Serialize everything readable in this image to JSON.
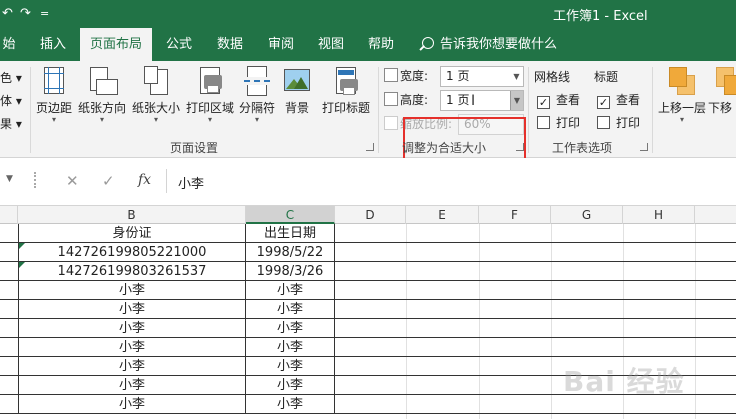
{
  "window": {
    "title": "工作簿1 - Excel",
    "undo_glyph": "↶",
    "redo_glyph": "↷",
    "qat_more": "="
  },
  "tabs": [
    {
      "label": "始",
      "active": false
    },
    {
      "label": "插入",
      "active": false
    },
    {
      "label": "页面布局",
      "active": true
    },
    {
      "label": "公式",
      "active": false
    },
    {
      "label": "数据",
      "active": false
    },
    {
      "label": "审阅",
      "active": false
    },
    {
      "label": "视图",
      "active": false
    },
    {
      "label": "帮助",
      "active": false
    }
  ],
  "tell_me": "告诉我你想要做什么",
  "ribbon": {
    "left_edge": [
      "色 ▾",
      "体 ▾",
      "果 ▾"
    ],
    "page_setup": {
      "buttons": [
        {
          "label": "页边距",
          "icon": "margins-icon"
        },
        {
          "label": "纸张方向",
          "icon": "orientation-icon"
        },
        {
          "label": "纸张大小",
          "icon": "size-icon"
        },
        {
          "label": "打印区域",
          "icon": "print-area-icon"
        },
        {
          "label": "分隔符",
          "icon": "breaks-icon"
        },
        {
          "label": "背景",
          "icon": "background-icon"
        },
        {
          "label": "打印标题",
          "icon": "print-titles-icon"
        }
      ],
      "label": "页面设置"
    },
    "scale_to_fit": {
      "width_label": "宽度:",
      "width_value": "1 页",
      "height_label": "高度:",
      "height_value": "1 页",
      "scale_label": "缩放比例:",
      "scale_value": "60%",
      "label": "调整为合适大小"
    },
    "sheet_options": {
      "gridlines_label": "网格线",
      "headings_label": "标题",
      "view_label": "查看",
      "print_label": "打印",
      "label": "工作表选项"
    },
    "arrange": {
      "bring_forward": "上移一层",
      "send_backward": "下移"
    }
  },
  "formula_bar": {
    "cancel": "✕",
    "enter": "✓",
    "fx": "fx",
    "content": "小李"
  },
  "columns": [
    "B",
    "C",
    "D",
    "E",
    "F",
    "G",
    "H"
  ],
  "rows": [
    {
      "b": "身份证",
      "c": "出生日期"
    },
    {
      "b": "142726199805221000",
      "c": "1998/5/22"
    },
    {
      "b": "142726199803261537",
      "c": "1998/3/26"
    },
    {
      "b": "小李",
      "c": "小李"
    },
    {
      "b": "小李",
      "c": "小李"
    },
    {
      "b": "小李",
      "c": "小李"
    },
    {
      "b": "小李",
      "c": "小李"
    },
    {
      "b": "小李",
      "c": "小李"
    },
    {
      "b": "小李",
      "c": "小李"
    },
    {
      "b": "小李",
      "c": "小李"
    }
  ],
  "watermark": "Bai 经验"
}
